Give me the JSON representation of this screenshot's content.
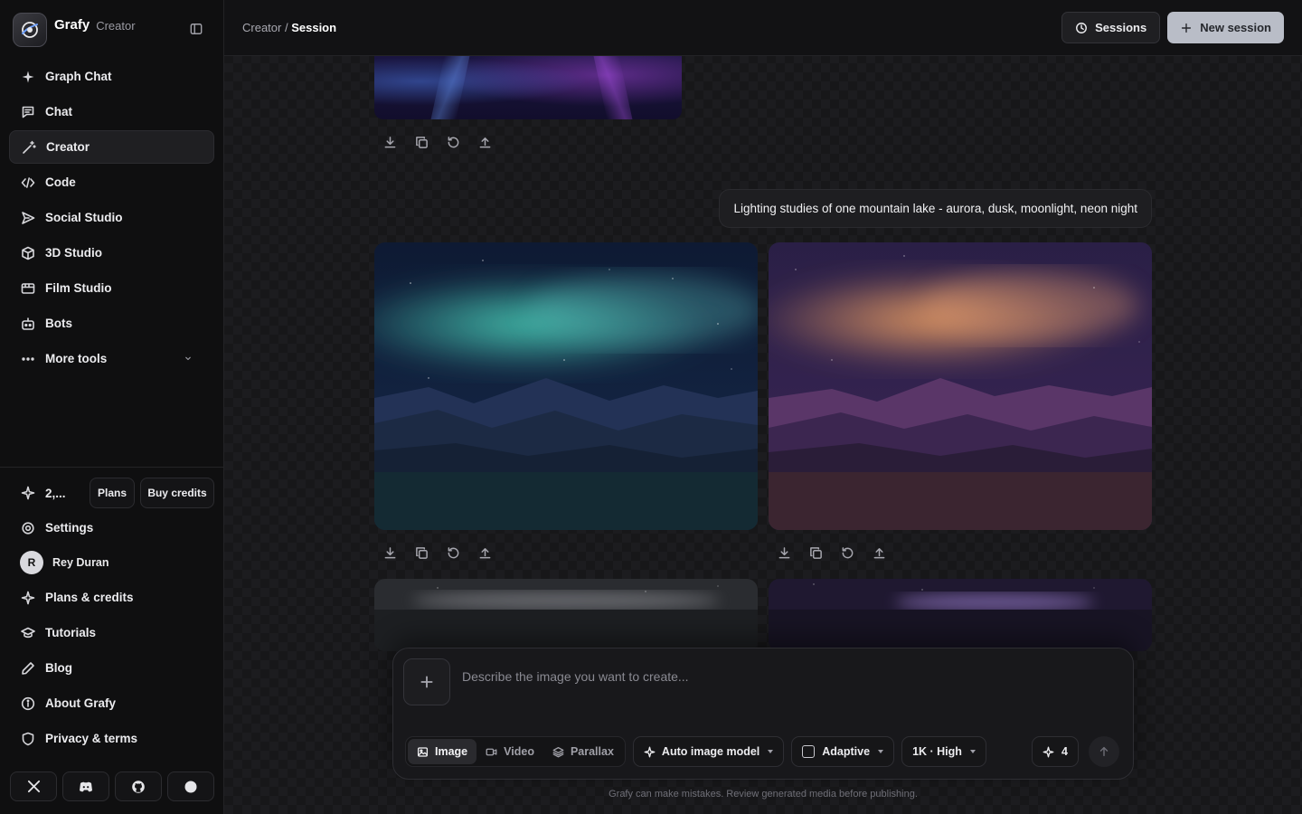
{
  "brand": {
    "name": "Grafy",
    "subtitle": "Creator"
  },
  "nav": {
    "items": [
      {
        "label": "Graph Chat",
        "icon": "sparkle-icon"
      },
      {
        "label": "Chat",
        "icon": "chat-icon"
      },
      {
        "label": "Creator",
        "icon": "wand-icon",
        "active": true
      },
      {
        "label": "Code",
        "icon": "code-icon"
      },
      {
        "label": "Social Studio",
        "icon": "send-icon"
      },
      {
        "label": "3D Studio",
        "icon": "cube-icon"
      },
      {
        "label": "Film Studio",
        "icon": "film-icon"
      },
      {
        "label": "Bots",
        "icon": "bot-icon"
      },
      {
        "label": "More tools",
        "icon": "more-icon"
      }
    ]
  },
  "credits": {
    "value": "2,...",
    "plans_label": "Plans",
    "buy_label": "Buy credits"
  },
  "bottom_nav": {
    "settings": "Settings",
    "user": {
      "initial": "R",
      "name": "Rey Duran"
    },
    "plans_credits": "Plans & credits",
    "tutorials": "Tutorials",
    "blog": "Blog",
    "about": "About Grafy",
    "privacy": "Privacy & terms"
  },
  "socials": [
    "x-icon",
    "discord-icon",
    "github-icon",
    "circle-icon"
  ],
  "header": {
    "breadcrumb_parent": "Creator /",
    "breadcrumb_current": "Session",
    "sessions_label": "Sessions",
    "new_session_label": "New session"
  },
  "conversation": {
    "prompt": "Lighting studies of one mountain lake - aurora, dusk, moonlight, neon night",
    "images": [
      {
        "name": "aurora",
        "sky_glow": "#3fb8a8"
      },
      {
        "name": "dusk",
        "sky_glow": "#e09060"
      },
      {
        "name": "moonlight",
        "sky_glow": "#9a9aa0"
      },
      {
        "name": "neon night",
        "sky_glow": "#9a70d8"
      }
    ]
  },
  "composer": {
    "placeholder": "Describe the image you want to create...",
    "modes": [
      {
        "label": "Image",
        "active": true
      },
      {
        "label": "Video",
        "active": false
      },
      {
        "label": "Parallax",
        "active": false
      }
    ],
    "model_label": "Auto image model",
    "aspect_label": "Adaptive",
    "quality_label": "1K · High",
    "count_label": "4"
  },
  "disclaimer": "Grafy can make mistakes. Review generated media before publishing.",
  "colors": {
    "accent_button": "#b9bdc7",
    "background": "#161618",
    "sidebar": "#0f0f10"
  }
}
